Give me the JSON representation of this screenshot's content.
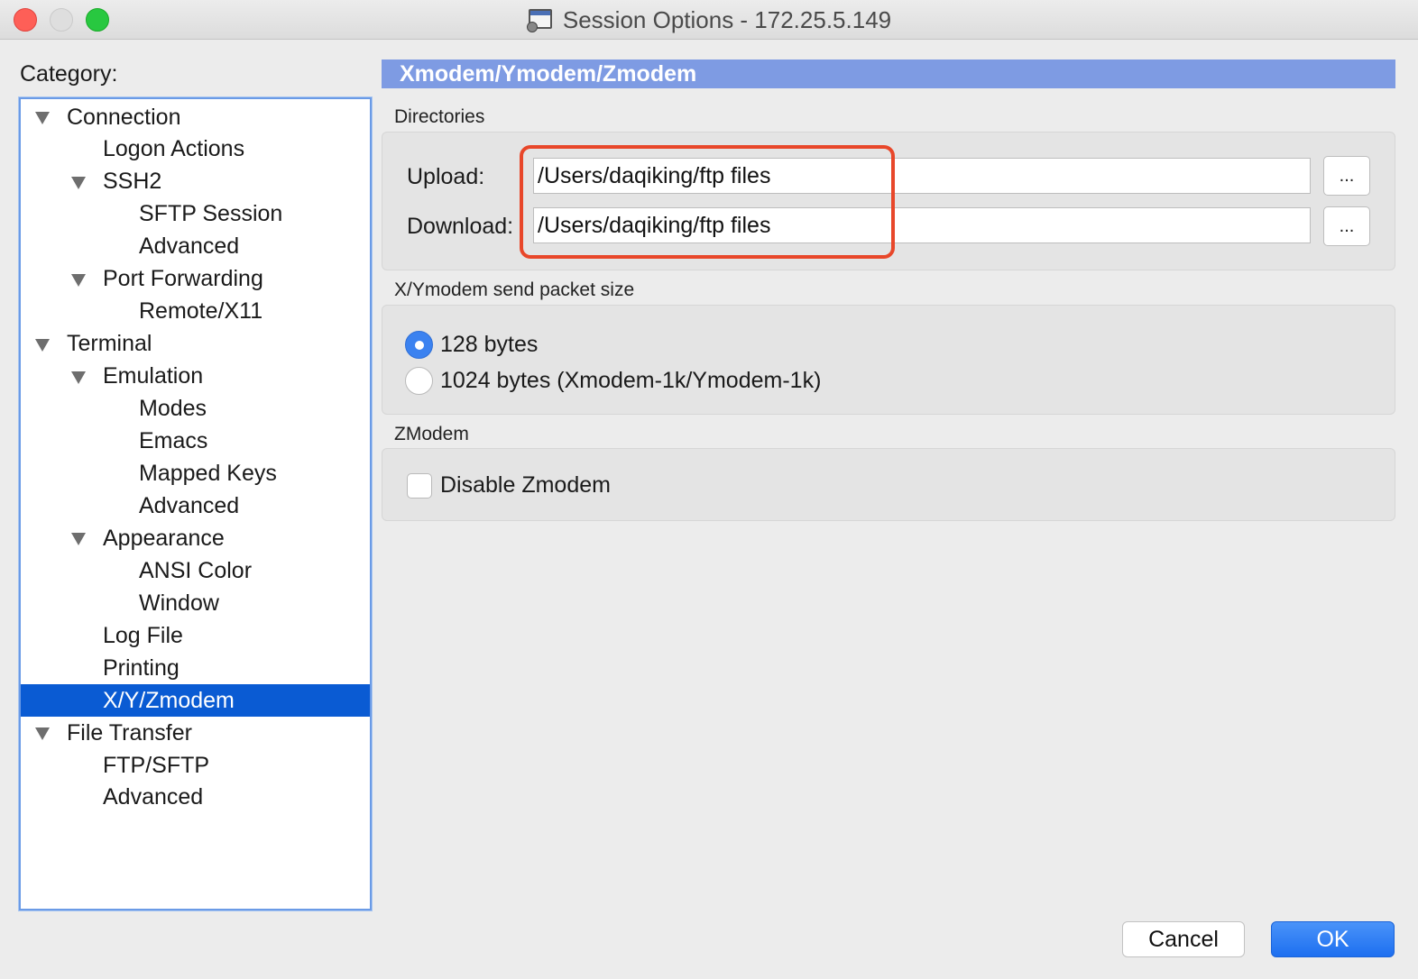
{
  "window": {
    "title": "Session Options - 172.25.5.149"
  },
  "category": {
    "label": "Category:",
    "items": [
      {
        "label": "Connection",
        "level": 0,
        "expandable": true,
        "selected": false
      },
      {
        "label": "Logon Actions",
        "level": 1,
        "expandable": false,
        "selected": false
      },
      {
        "label": "SSH2",
        "level": 1,
        "expandable": true,
        "selected": false
      },
      {
        "label": "SFTP Session",
        "level": 2,
        "expandable": false,
        "selected": false
      },
      {
        "label": "Advanced",
        "level": 2,
        "expandable": false,
        "selected": false
      },
      {
        "label": "Port Forwarding",
        "level": 1,
        "expandable": true,
        "selected": false
      },
      {
        "label": "Remote/X11",
        "level": 2,
        "expandable": false,
        "selected": false
      },
      {
        "label": "Terminal",
        "level": 0,
        "expandable": true,
        "selected": false
      },
      {
        "label": "Emulation",
        "level": 1,
        "expandable": true,
        "selected": false
      },
      {
        "label": "Modes",
        "level": 2,
        "expandable": false,
        "selected": false
      },
      {
        "label": "Emacs",
        "level": 2,
        "expandable": false,
        "selected": false
      },
      {
        "label": "Mapped Keys",
        "level": 2,
        "expandable": false,
        "selected": false
      },
      {
        "label": "Advanced",
        "level": 2,
        "expandable": false,
        "selected": false
      },
      {
        "label": "Appearance",
        "level": 1,
        "expandable": true,
        "selected": false
      },
      {
        "label": "ANSI Color",
        "level": 2,
        "expandable": false,
        "selected": false
      },
      {
        "label": "Window",
        "level": 2,
        "expandable": false,
        "selected": false
      },
      {
        "label": "Log File",
        "level": 1,
        "expandable": false,
        "selected": false
      },
      {
        "label": "Printing",
        "level": 1,
        "expandable": false,
        "selected": false
      },
      {
        "label": "X/Y/Zmodem",
        "level": 1,
        "expandable": false,
        "selected": true
      },
      {
        "label": "File Transfer",
        "level": 0,
        "expandable": true,
        "selected": false
      },
      {
        "label": "FTP/SFTP",
        "level": 1,
        "expandable": false,
        "selected": false
      },
      {
        "label": "Advanced",
        "level": 1,
        "expandable": false,
        "selected": false
      }
    ]
  },
  "panel": {
    "header": "Xmodem/Ymodem/Zmodem",
    "directories": {
      "label": "Directories",
      "upload_label": "Upload:",
      "upload_value": "/Users/daqiking/ftp files",
      "download_label": "Download:",
      "download_value": "/Users/daqiking/ftp files",
      "browse_label": "..."
    },
    "packet_size": {
      "label": "X/Ymodem send packet size",
      "options": [
        {
          "label": "128 bytes",
          "selected": true
        },
        {
          "label": "1024 bytes (Xmodem-1k/Ymodem-1k)",
          "selected": false
        }
      ]
    },
    "zmodem": {
      "label": "ZModem",
      "disable_label": "Disable Zmodem",
      "disable_checked": false
    }
  },
  "buttons": {
    "cancel": "Cancel",
    "ok": "OK"
  },
  "colors": {
    "selection": "#0a5bd3",
    "header_bar": "#7e9be3",
    "highlight_annotation": "#e8472a",
    "ok_button": "#1d6ff0"
  }
}
